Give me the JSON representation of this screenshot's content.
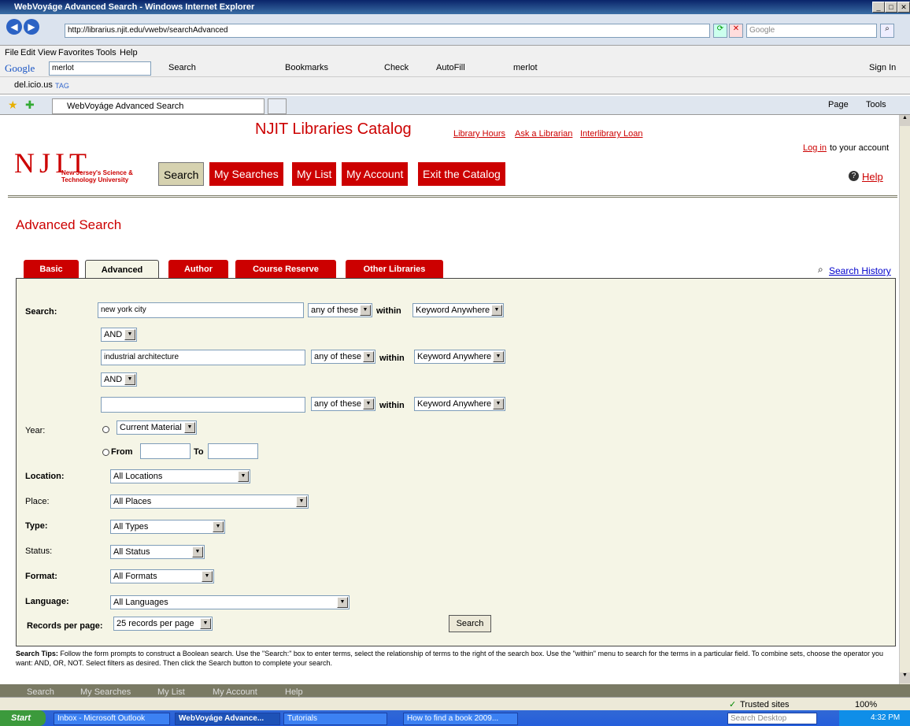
{
  "window": {
    "title": "WebVoyáge Advanced Search - Windows Internet Explorer"
  },
  "browser": {
    "address": "http://librarius.njit.edu/vwebv/searchAdvanced",
    "search_placeholder": "Google",
    "menu": [
      "File",
      "Edit",
      "View",
      "Favorites",
      "Tools",
      "Help"
    ],
    "google_query": "merlot",
    "google_toolbar": [
      "Search",
      "Bookmarks",
      "Check",
      "AutoFill",
      "merlot"
    ],
    "sign_in": "Sign In",
    "delicious": "del.icio.us",
    "tag": "TAG",
    "tab_title": "WebVoyáge Advanced Search",
    "cmd": [
      "Page",
      "Tools"
    ]
  },
  "header": {
    "title": "NJIT Libraries Catalog",
    "links": [
      "Library Hours",
      "Ask a Librarian",
      "Interlibrary Loan"
    ],
    "logo_text": "NJIT",
    "logo_sub1": "New Jersey's Science &",
    "logo_sub2": "Technology University",
    "login_link": "Log in",
    "login_rest": " to your account",
    "help": "Help",
    "nav": [
      "Search",
      "My Searches",
      "My List",
      "My Account",
      "Exit the Catalog"
    ]
  },
  "page_title": "Advanced Search",
  "tabs": [
    "Basic",
    "Advanced",
    "Author",
    "Course Reserve",
    "Other Libraries"
  ],
  "search_history": "Search History",
  "form": {
    "search_label": "Search:",
    "rows": [
      {
        "term": "new york city",
        "mode": "any of these",
        "field": "Keyword Anywhere"
      },
      {
        "term": "industrial architecture",
        "mode": "any of these",
        "field": "Keyword Anywhere"
      },
      {
        "term": "",
        "mode": "any of these",
        "field": "Keyword Anywhere"
      }
    ],
    "within": "within",
    "operator": "AND",
    "year_label": "Year:",
    "year_current": "Current Material",
    "from": "From",
    "to": "To",
    "location_label": "Location:",
    "location": "All Locations",
    "place_label": "Place:",
    "place": "All Places",
    "type_label": "Type:",
    "type": "All Types",
    "status_label": "Status:",
    "status": "All Status",
    "format_label": "Format:",
    "format": "All Formats",
    "language_label": "Language:",
    "language": "All Languages",
    "rpp_label": "Records per page:",
    "rpp": "25 records per page",
    "search_button": "Search"
  },
  "tips": {
    "heading": "Search Tips:",
    "text": "Follow the form prompts to construct a Boolean search. Use the \"Search:\" box to enter terms, select the relationship of terms to the right of the search box. Use the \"within\" menu to search for the terms in a particular field. To combine sets, choose the operator you want: AND, OR, NOT. Select filters as desired. Then click the Search button to complete your search."
  },
  "footer_nav": [
    "Search",
    "My Searches",
    "My List",
    "My Account",
    "Help"
  ],
  "status": {
    "zone": "Trusted sites",
    "zoom": "100%"
  },
  "taskbar": {
    "start": "Start",
    "items": [
      "Inbox - Microsoft Outlook",
      "WebVoyáge Advance...",
      "Tutorials",
      "How to find a book 2009..."
    ],
    "search_desktop": "Search Desktop",
    "clock": "4:32 PM"
  }
}
